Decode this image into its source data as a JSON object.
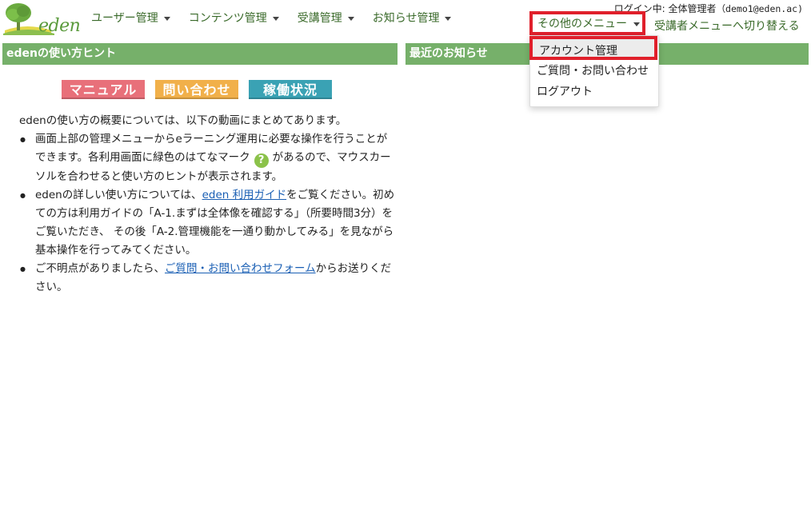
{
  "brand": {
    "logo_text": "eden",
    "colors": {
      "green": "#76b06a",
      "highlight": "#e0202b",
      "link": "#1a5fb4"
    }
  },
  "header": {
    "nav": [
      {
        "label": "ユーザー管理"
      },
      {
        "label": "コンテンツ管理"
      },
      {
        "label": "受講管理"
      },
      {
        "label": "お知らせ管理"
      }
    ],
    "login_prefix": "ログイン中:",
    "login_user": "全体管理者",
    "login_email": "（demo1@eden.ac)",
    "other_menu": "その他のメニュー",
    "switch_link": "受講者メニューへ切り替える"
  },
  "dropdown": {
    "items": [
      "アカウント管理",
      "ご質問・お問い合わせ",
      "ログアウト"
    ]
  },
  "panels": {
    "left_title": "edenの使い方ヒント",
    "right_title": "最近のお知らせ"
  },
  "buttons": {
    "manual": "マニュアル",
    "contact": "問い合わせ",
    "status": "稼働状況"
  },
  "hints": {
    "intro": "edenの使い方の概要については、以下の動画にまとめてあります。",
    "b1_pre": "画面上部の管理メニューからeラーニング運用に必要な操作を行うことができます。各利用画面に緑色のはてなマーク",
    "b1_post": "があるので、マウスカーソルを合わせると使い方のヒントが表示されます。",
    "help_mark": "?",
    "b2_pre": "edenの詳しい使い方については、",
    "b2_link": "eden 利用ガイド",
    "b2_post": "をご覧ください。初めての方は利用ガイドの「A-1.まずは全体像を確認する」（所要時間3分）をご覧いただき、 その後「A-2.管理機能を一通り動かしてみる」を見ながら基本操作を行ってみてください。",
    "b3_pre": "ご不明点がありましたら、",
    "b3_link": "ご質問・お問い合わせフォーム",
    "b3_post": "からお送りください。"
  }
}
